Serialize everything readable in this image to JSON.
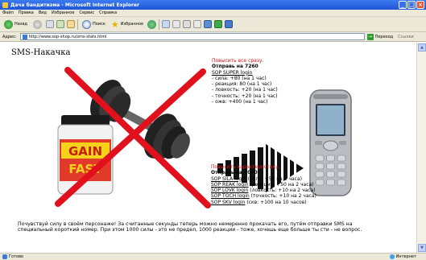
{
  "window": {
    "title": "Дача бандитизма - Microsoft Internet Explorer",
    "buttons": {
      "minimize": "_",
      "maximize": "□",
      "close": "×"
    }
  },
  "menubar": [
    "Файл",
    "Правка",
    "Вид",
    "Избранное",
    "Сервис",
    "Справка"
  ],
  "toolbar": {
    "back": "Назад",
    "search": "Поиск",
    "favorites": "Избранное"
  },
  "address": {
    "label": "Адрес:",
    "url": "http://www.sop-shop.ru/sms-stats.html",
    "go": "Переход",
    "links": "Ссылки"
  },
  "page": {
    "title": "SMS-Накачка",
    "block1": {
      "heading": "Повысить все сразу.",
      "send_to": "Отправь на 7260",
      "code": "SOP SUPER login",
      "stats": [
        "- сила: +80 (на 1 час)",
        "- реакция: 80 (на 1 час)",
        "- ловкость: +20 (на 1 час)",
        "- точность: +20 (на 1 час)",
        "- ожв: +400 (на 1 час)"
      ]
    },
    "block2": {
      "heading": "Повысить характеристику.",
      "send_to": "Отправь на 7090",
      "items": [
        {
          "code": "SOP SILA login",
          "desc": "(сила: +50 на 2 часа)"
        },
        {
          "code": "SOP REAK login",
          "desc": "(реакция: +50 на 2 часа)"
        },
        {
          "code": "SOP LOVK login",
          "desc": "(ловкость: +10 на 2 часа)"
        },
        {
          "code": "SOP TOCH login",
          "desc": "(точность: +10 на 2 часа)"
        },
        {
          "code": "SOP SKV login",
          "desc": "(скв: +100 на 10 часов)"
        }
      ]
    },
    "product_label": {
      "line1": "GAIN",
      "line2": "FAST"
    },
    "bottom_text": "Почувствуй силу в своём персонаже! За считанные секунды теперь можно немеренно прокачать его, путём отправки SMS на специальный короткий номер. При этом 1000 силы - это не предел, 1000 реакции - тоже, хочешь еще больше ты сти - не вопрос."
  },
  "status": {
    "left": "Готово",
    "right": "Интернет"
  },
  "colors": {
    "accent_red": "#d8141c",
    "title_blue": "#1f55d6"
  }
}
